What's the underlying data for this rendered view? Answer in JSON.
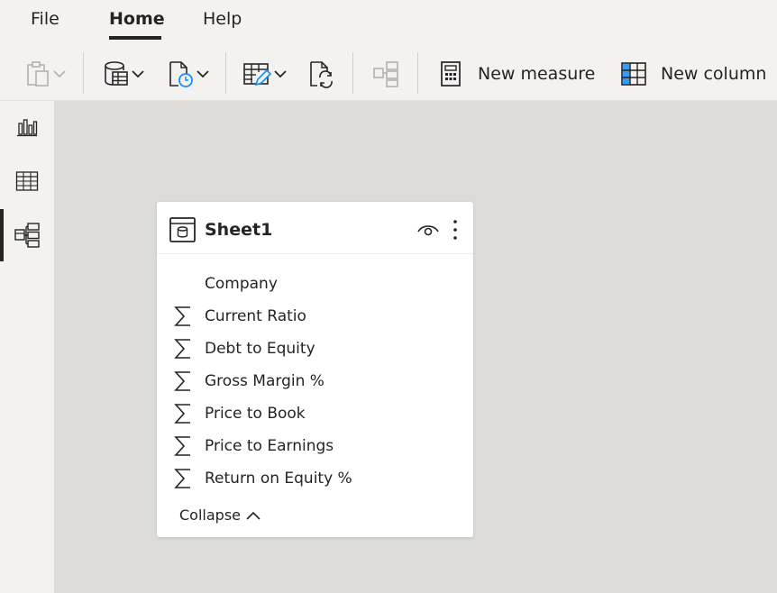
{
  "menu": {
    "tabs": [
      {
        "label": "File"
      },
      {
        "label": "Home"
      },
      {
        "label": "Help"
      }
    ],
    "active_tab": "Home"
  },
  "ribbon": {
    "new_measure_label": "New measure",
    "new_column_label": "New column"
  },
  "left_rail": {
    "items": [
      "report-view-icon",
      "data-view-icon",
      "model-view-icon"
    ],
    "active": "model-view-icon"
  },
  "table_card": {
    "title": "Sheet1",
    "fields": [
      {
        "label": "Company",
        "icon": "none"
      },
      {
        "label": "Current Ratio",
        "icon": "sigma-icon"
      },
      {
        "label": "Debt to Equity",
        "icon": "sigma-icon"
      },
      {
        "label": "Gross Margin %",
        "icon": "sigma-icon"
      },
      {
        "label": "Price to Book",
        "icon": "sigma-icon"
      },
      {
        "label": "Price to Earnings",
        "icon": "sigma-icon"
      },
      {
        "label": "Return on Equity %",
        "icon": "sigma-icon"
      }
    ],
    "collapse_label": "Collapse"
  },
  "colors": {
    "background": "#f3f2f1",
    "canvas": "#dcdbd8",
    "card": "#ffffff",
    "text": "#252423",
    "accent_blue": "#118dff"
  }
}
